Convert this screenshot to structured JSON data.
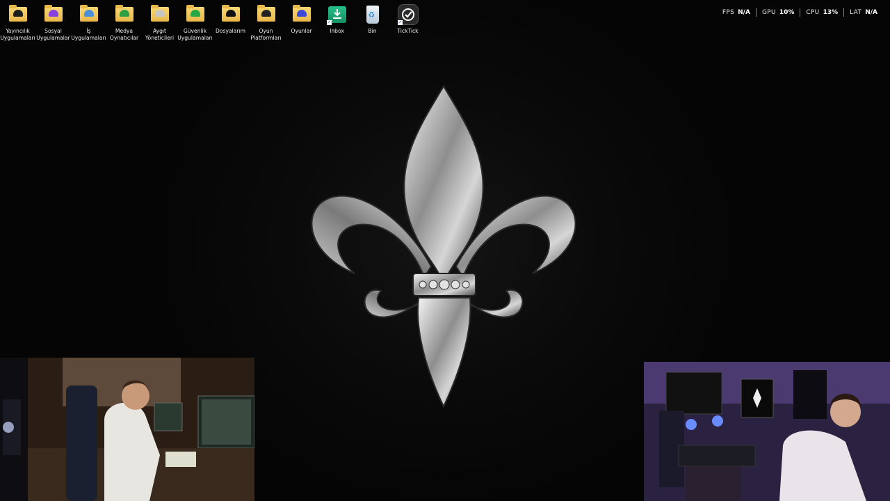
{
  "desktop": {
    "icons": [
      {
        "name": "yayincilik-uygulamalari",
        "label": "Yayıncılık\nUygulamaları",
        "prefix": "⊞",
        "badge_color": "#1d1d1d",
        "icon": "folder-icon"
      },
      {
        "name": "sosyal-uygulamalar",
        "label": "Sosyal\nUygulamalar",
        "prefix": "◌",
        "badge_color": "#8a3fe0",
        "icon": "folder-icon"
      },
      {
        "name": "is-uygulamalari",
        "label": "İş\nUygulamaları",
        "prefix": "◎",
        "badge_color": "#4a8fd8",
        "icon": "folder-icon"
      },
      {
        "name": "medya-oynaticilar",
        "label": "Medya\nOynatıcılar",
        "prefix": "∩",
        "badge_color": "#2ea043",
        "icon": "folder-icon"
      },
      {
        "name": "aygit-yoneticileri",
        "label": "Aygıt\nYöneticileri",
        "prefix": "⚙",
        "badge_color": "#c6c6c6",
        "icon": "folder-icon"
      },
      {
        "name": "guvenlik-uygulamalari",
        "label": "Güvenlik\nUygulamaları",
        "prefix": "◖",
        "badge_color": "#27a845",
        "icon": "folder-icon"
      },
      {
        "name": "dosyalarim",
        "label": "Dosyalarım",
        "prefix": "□",
        "badge_color": "#111111",
        "icon": "folder-icon"
      },
      {
        "name": "oyun-platformlari",
        "label": "Oyun\nPlatformları",
        "prefix": "■",
        "badge_color": "#222222",
        "icon": "folder-icon"
      },
      {
        "name": "oyunlar",
        "label": "Oyunlar",
        "prefix": "⊙",
        "badge_color": "#3b4bd8",
        "icon": "folder-icon"
      },
      {
        "name": "inbox",
        "label": "Inbox",
        "prefix": "▣",
        "icon": "inbox-download-icon"
      },
      {
        "name": "bin",
        "label": "Bin",
        "prefix": "■",
        "icon": "recycle-bin-icon"
      },
      {
        "name": "ticktick",
        "label": "TickTick",
        "prefix": "",
        "icon": "ticktick-icon"
      }
    ]
  },
  "perf_overlay": {
    "fps_label": "FPS",
    "fps_value": "N/A",
    "gpu_label": "GPU",
    "gpu_value": "10%",
    "cpu_label": "CPU",
    "cpu_value": "13%",
    "lat_label": "LAT",
    "lat_value": "N/A"
  },
  "wallpaper": {
    "emblem": "fleur-de-lis",
    "accent": "#c8c8c8"
  },
  "webcams": [
    {
      "name": "webcam-left",
      "subject": "person-at-desk"
    },
    {
      "name": "webcam-right",
      "subject": "person-closeup"
    }
  ]
}
